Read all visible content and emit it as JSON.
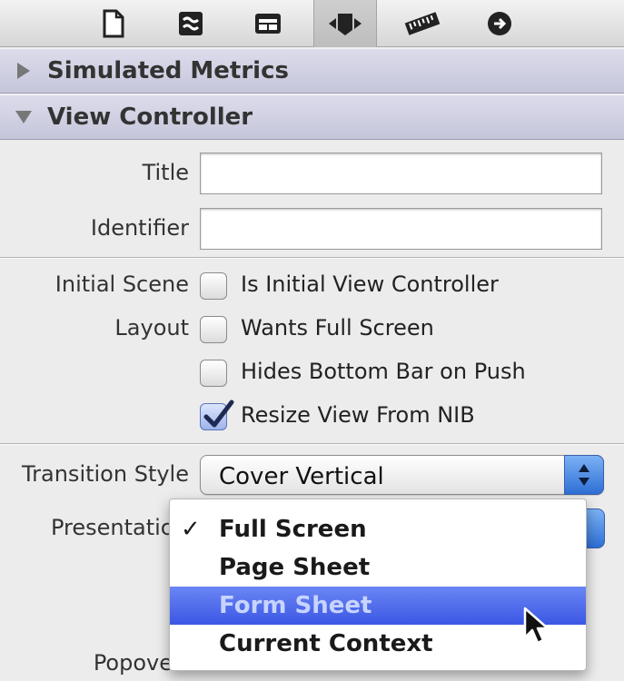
{
  "toolbar": {
    "icons": [
      "file-icon",
      "quick-help-icon",
      "identity-icon",
      "attributes-icon",
      "size-ruler-icon",
      "connections-icon"
    ],
    "selected": "attributes-icon"
  },
  "sections": {
    "simulated_metrics": "Simulated Metrics",
    "view_controller": "View Controller"
  },
  "fields": {
    "title_label": "Title",
    "title_value": "",
    "identifier_label": "Identifier",
    "identifier_value": ""
  },
  "options": {
    "initial_scene_label": "Initial Scene",
    "is_initial_label": "Is Initial View Controller",
    "is_initial_checked": false,
    "layout_label": "Layout",
    "wants_full_screen_label": "Wants Full Screen",
    "wants_full_screen_checked": false,
    "hides_bottom_bar_label": "Hides Bottom Bar on Push",
    "hides_bottom_bar_checked": false,
    "resize_view_label": "Resize View From NIB",
    "resize_view_checked": true
  },
  "transition": {
    "label": "Transition Style",
    "value": "Cover Vertical"
  },
  "presentation": {
    "label": "Presentatic",
    "menu": [
      {
        "label": "Full Screen",
        "checked": true,
        "highlighted": false
      },
      {
        "label": "Page Sheet",
        "checked": false,
        "highlighted": false
      },
      {
        "label": "Form Sheet",
        "checked": false,
        "highlighted": true
      },
      {
        "label": "Current Context",
        "checked": false,
        "highlighted": false
      }
    ],
    "check_glyph": "✓"
  },
  "popover": {
    "label": "Popove"
  },
  "colors": {
    "header_bg": "#c9cadd",
    "highlight": "#4a66ea",
    "stepper": "#3d7ee0"
  }
}
